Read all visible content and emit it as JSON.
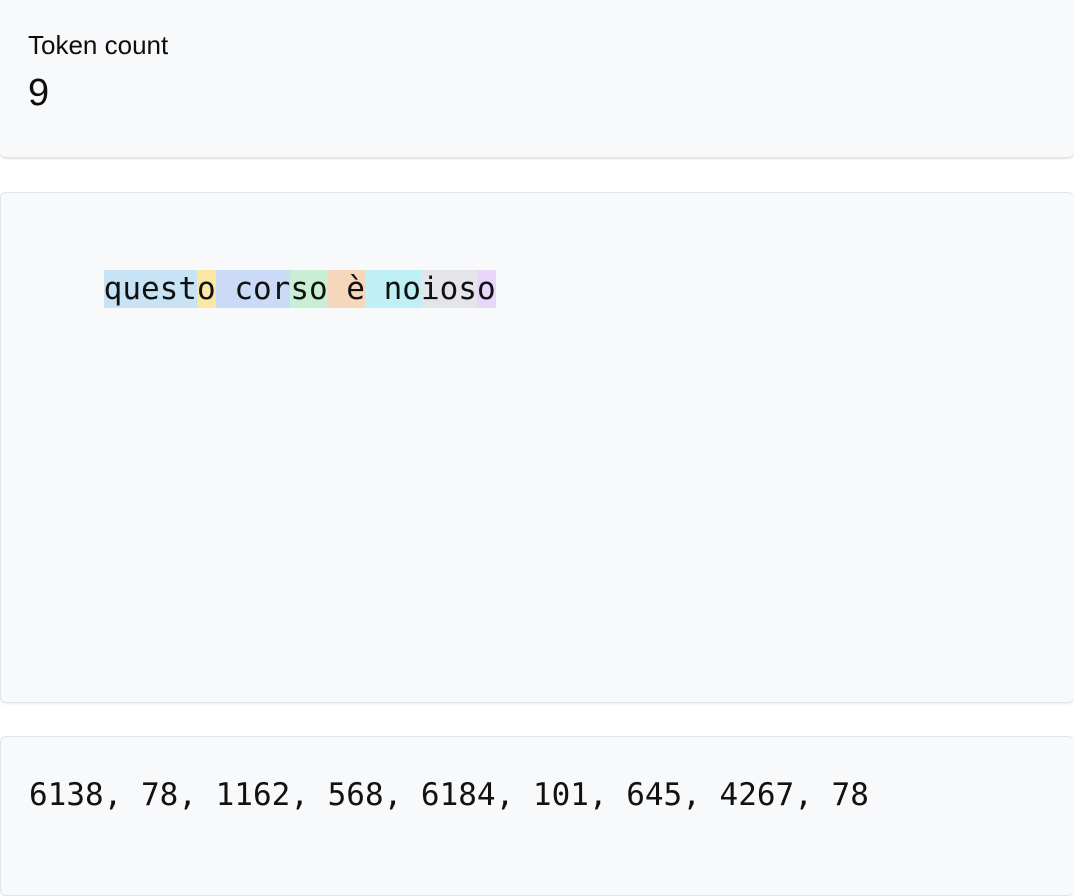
{
  "token_count": {
    "label": "Token count",
    "value": "9"
  },
  "tokens": [
    {
      "text": "quest",
      "color": "#c7e3f5"
    },
    {
      "text": "o",
      "color": "#fbe7a4"
    },
    {
      "text": " cor",
      "color": "#cadaf7"
    },
    {
      "text": "so",
      "color": "#c8efd4"
    },
    {
      "text": " è",
      "color": "#f7d7bb"
    },
    {
      "text": " no",
      "color": "#bff0f5"
    },
    {
      "text": "ios",
      "color": "#e4e5e8"
    },
    {
      "text": "o",
      "color": "#e8d7fa"
    }
  ],
  "token_ids": "6138, 78, 1162, 568, 6184, 101, 645, 4267, 78"
}
